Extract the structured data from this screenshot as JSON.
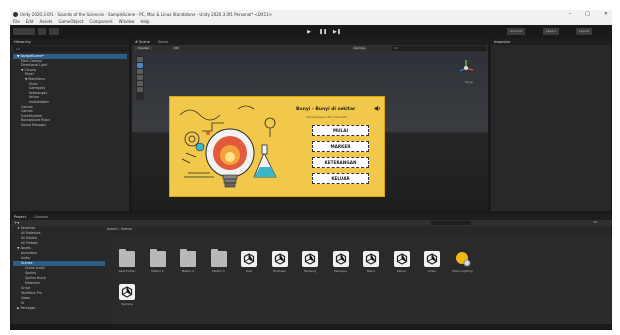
{
  "window": {
    "title": "Unity 2020.3.0f1 - Sounds of the Sciences - SampleScene - PC, Mac & Linux Standalone - Unity 2020.3.0f1 Personal* <DX11>",
    "controls": [
      "–",
      "□",
      "✕"
    ]
  },
  "menu": [
    "File",
    "Edit",
    "Assets",
    "GameObject",
    "Component",
    "Window",
    "Help"
  ],
  "toolbar": {
    "left_tools": [
      "hand-tool",
      "move-tool"
    ],
    "play": [
      "▶",
      "❚❚",
      "▶❚"
    ],
    "account": "Account",
    "layers": "Layers",
    "layout": "Layout"
  },
  "hierarchy": {
    "tab": "Hierarchy",
    "search_placeholder": "All",
    "rows": [
      {
        "label": "▼ SampleScene*",
        "indent": 1,
        "selected": true
      },
      {
        "label": "Main Camera",
        "indent": 2,
        "selected": false
      },
      {
        "label": "Directional Light",
        "indent": 2,
        "selected": false
      },
      {
        "label": "▼ Canvas",
        "indent": 2,
        "selected": false
      },
      {
        "label": "Panel",
        "indent": 3,
        "selected": false
      },
      {
        "label": "▼ MainMenu",
        "indent": 3,
        "selected": false
      },
      {
        "label": "Mulai",
        "indent": 4,
        "selected": false
      },
      {
        "label": "Gameplay",
        "indent": 4,
        "selected": false
      },
      {
        "label": "Keterangan",
        "indent": 4,
        "selected": false
      },
      {
        "label": "Keluar",
        "indent": 4,
        "selected": false
      },
      {
        "label": "AudioMaster",
        "indent": 4,
        "selected": false
      },
      {
        "label": "Canvas",
        "indent": 2,
        "selected": false
      },
      {
        "label": "Canvas",
        "indent": 2,
        "selected": false
      },
      {
        "label": "EventSystem",
        "indent": 2,
        "selected": false
      },
      {
        "label": "Background Music",
        "indent": 2,
        "selected": false
      },
      {
        "label": "Sound Manager",
        "indent": 2,
        "selected": false
      }
    ]
  },
  "scene": {
    "tabs": [
      "# Scene",
      "Game"
    ],
    "mode": "Shaded",
    "view2d": "2D",
    "gizmos": "Gizmos",
    "search": "All",
    "persp": "Persp"
  },
  "game_ui": {
    "title": "Bunyi - Bunyi di sekitar",
    "subtitle": "Pembelajaran IPA Interaktif",
    "buttons": [
      "MULAI",
      "MARKER",
      "KETERANGAN",
      "KELUAR"
    ]
  },
  "inspector": {
    "tab": "Inspector"
  },
  "project": {
    "tabs": [
      "Project",
      "Console"
    ],
    "breadcrumb": [
      "Assets",
      "Scenes"
    ],
    "tree": [
      {
        "label": "★ Favorites",
        "indent": 1,
        "selected": false
      },
      {
        "label": "All Materials",
        "indent": 2,
        "selected": false
      },
      {
        "label": "All Models",
        "indent": 2,
        "selected": false
      },
      {
        "label": "All Prefabs",
        "indent": 2,
        "selected": false
      },
      {
        "label": "▼ Assets",
        "indent": 1,
        "selected": false
      },
      {
        "label": "Animation",
        "indent": 2,
        "selected": false
      },
      {
        "label": "Audio",
        "indent": 2,
        "selected": false
      },
      {
        "label": "Scenes",
        "indent": 2,
        "selected": true
      },
      {
        "label": "Scene Audio",
        "indent": 3,
        "selected": false
      },
      {
        "label": "Sprites",
        "indent": 3,
        "selected": false
      },
      {
        "label": "Sprites Bunyi",
        "indent": 3,
        "selected": false
      },
      {
        "label": "Materials",
        "indent": 3,
        "selected": false
      },
      {
        "label": "Script",
        "indent": 2,
        "selected": false
      },
      {
        "label": "TextMesh Pro",
        "indent": 2,
        "selected": false
      },
      {
        "label": "Video",
        "indent": 2,
        "selected": false
      },
      {
        "label": "UI",
        "indent": 2,
        "selected": false
      },
      {
        "label": "▶ Packages",
        "indent": 1,
        "selected": false
      }
    ],
    "assets": [
      {
        "label": "Aset Folder",
        "icon": "folder-icon"
      },
      {
        "label": "Materi 1",
        "icon": "folder-icon"
      },
      {
        "label": "Materi 2",
        "icon": "folder-icon"
      },
      {
        "label": "Materi 3",
        "icon": "folder-icon"
      },
      {
        "label": "Kuis",
        "icon": "unity-scene-icon"
      },
      {
        "label": "Evaluasi",
        "icon": "unity-scene-icon"
      },
      {
        "label": "Tentang",
        "icon": "unity-scene-icon"
      },
      {
        "label": "Petunjuk",
        "icon": "unity-scene-icon"
      },
      {
        "label": "Menu",
        "icon": "unity-scene-icon"
      },
      {
        "label": "Keluar",
        "icon": "unity-scene-icon"
      },
      {
        "label": "Video",
        "icon": "unity-scene-icon"
      },
      {
        "label": "Main Lighting",
        "icon": "lighting-settings-icon"
      },
      {
        "label": "Sample",
        "icon": "unity-scene-icon"
      }
    ],
    "item_count": "14"
  },
  "colors": {
    "selection": "#2c5d87",
    "game_bg": "#f2c84b",
    "editor_bg": "#282828"
  }
}
